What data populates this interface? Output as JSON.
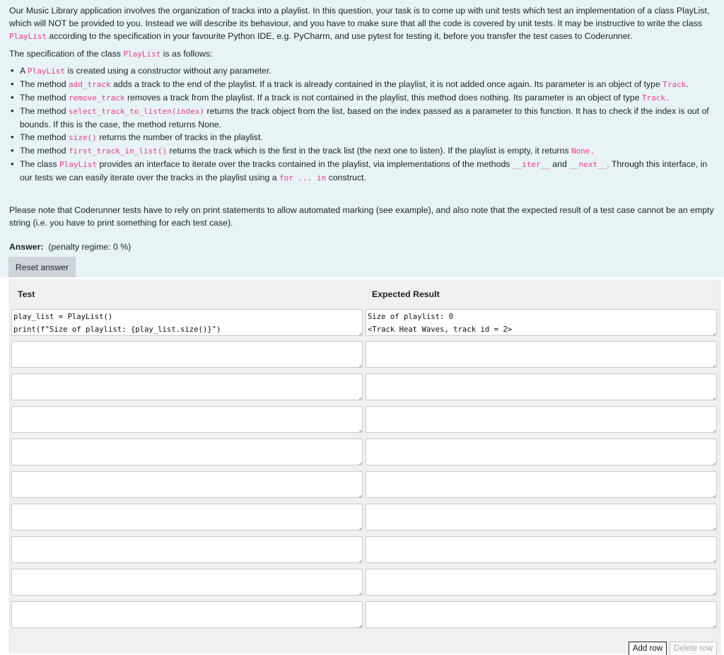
{
  "question": {
    "intro": [
      {
        "t": "Our Music Library application involves the organization of tracks into a playlist. In this question, your task is to come up with unit tests which test an implementation of a class PlayList, which will NOT be provided to you. Instead we will describe its behaviour, and you have to make sure that all the code is covered by unit tests. It may be instructive to write the class "
      },
      {
        "c": "PlayList"
      },
      {
        "t": " according to the specification in your favourite Python IDE, e.g. PyCharm, and use pytest for testing it, before you transfer the test cases to Coderunner."
      }
    ],
    "spec_title": [
      {
        "t": "The specification of the class "
      },
      {
        "c": "PlayList"
      },
      {
        "t": " is as follows:"
      }
    ],
    "spec_items": [
      [
        {
          "t": "A "
        },
        {
          "c": "PlayList"
        },
        {
          "t": " is created using a constructor without any parameter."
        }
      ],
      [
        {
          "t": "The method "
        },
        {
          "c": "add_track"
        },
        {
          "t": " adds a track to the end of the playlist. If a track is already contained in the playlist, it is not added once again. Its parameter is an object of type "
        },
        {
          "c": "Track"
        },
        {
          "t": "."
        }
      ],
      [
        {
          "t": "The method "
        },
        {
          "c": "remove_track"
        },
        {
          "t": "  removes a track from the playlist. If a track is not contained in the playlist, this method does nothing. Its parameter is an object of type "
        },
        {
          "c": "Track."
        }
      ],
      [
        {
          "t": "The method "
        },
        {
          "c": "select_track_to_listen(index)"
        },
        {
          "t": " returns the track object from the list, based on the index passed as a parameter to this function. It has to check if the index is out of bounds. If this is the case, the method returns None."
        }
      ],
      [
        {
          "t": "The method "
        },
        {
          "c": "size()"
        },
        {
          "t": " returns the number of tracks in the playlist."
        }
      ],
      [
        {
          "t": "The method "
        },
        {
          "c": "first_track_in_list()"
        },
        {
          "t": " returns the track which is the first in the track list (the next one to listen). If the playlist is empty, it returns "
        },
        {
          "c": "None."
        }
      ],
      [
        {
          "t": "The class "
        },
        {
          "c": "PlayList"
        },
        {
          "t": " provides an interface to iterate over the tracks contained in the playlist, via implementations of the methods "
        },
        {
          "c": "__iter__"
        },
        {
          "t": " and "
        },
        {
          "c": "__next__"
        },
        {
          "t": ". Through this interface, in our tests we can easily iterate over the tracks in the playlist using a "
        },
        {
          "c": "for ... in"
        },
        {
          "t": " construct."
        }
      ]
    ],
    "note": "Please note that Coderunner tests have to rely on print statements to allow automated marking (see example), and also note that the expected result of a test case cannot be an empty string (i.e. you have to print something for each test case)."
  },
  "answer": {
    "label": "Answer:",
    "penalty": "(penalty regime: 0 %)",
    "reset_label": "Reset answer"
  },
  "table": {
    "col_test": "Test",
    "col_expected": "Expected Result",
    "rows": [
      {
        "test": "play_list = PlayList()\nprint(f\"Size of playlist: {play_list.size()}\")",
        "expected": "Size of playlist: 0\n<Track Heat Waves, track id = 2>"
      },
      {
        "test": "",
        "expected": ""
      },
      {
        "test": "",
        "expected": ""
      },
      {
        "test": "",
        "expected": ""
      },
      {
        "test": "",
        "expected": ""
      },
      {
        "test": "",
        "expected": ""
      },
      {
        "test": "",
        "expected": ""
      },
      {
        "test": "",
        "expected": ""
      },
      {
        "test": "",
        "expected": ""
      },
      {
        "test": "",
        "expected": ""
      }
    ],
    "add_row_label": "Add row",
    "delete_row_label": "Delete row"
  },
  "colors": {
    "question_bg": "#e7f3f5",
    "code_pink": "#e83e8c",
    "button_grey": "#ced4da"
  }
}
